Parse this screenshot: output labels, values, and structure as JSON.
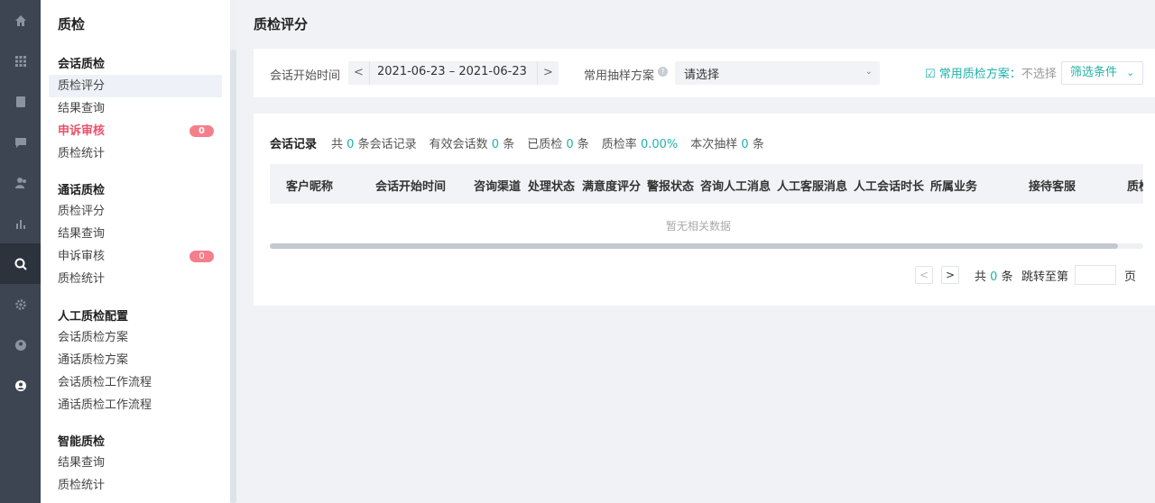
{
  "rail": {
    "items": [
      {
        "icon": "home-icon",
        "active": false
      },
      {
        "icon": "grid-icon",
        "active": false
      },
      {
        "icon": "document-icon",
        "active": false
      },
      {
        "icon": "chat-icon",
        "active": false
      },
      {
        "icon": "users-icon",
        "active": false
      },
      {
        "icon": "bar-chart-icon",
        "active": false
      },
      {
        "icon": "search-check-icon",
        "active": true
      },
      {
        "icon": "gear-icon",
        "active": false
      },
      {
        "icon": "user-circle-icon",
        "active": false
      },
      {
        "icon": "user-badge-icon",
        "active": false
      }
    ]
  },
  "sidebar": {
    "title": "质检",
    "groups": [
      {
        "title": "会话质检",
        "items": [
          {
            "label": "质检评分",
            "selected": true
          },
          {
            "label": "结果查询"
          },
          {
            "label": "申诉审核",
            "active": true,
            "badge": "0"
          },
          {
            "label": "质检统计"
          }
        ]
      },
      {
        "title": "通话质检",
        "items": [
          {
            "label": "质检评分"
          },
          {
            "label": "结果查询"
          },
          {
            "label": "申诉审核",
            "badge": "0"
          },
          {
            "label": "质检统计"
          }
        ]
      },
      {
        "title": "人工质检配置",
        "items": [
          {
            "label": "会话质检方案"
          },
          {
            "label": "通话质检方案"
          },
          {
            "label": "会话质检工作流程"
          },
          {
            "label": "通话质检工作流程"
          }
        ]
      },
      {
        "title": "智能质检",
        "items": [
          {
            "label": "结果查询"
          },
          {
            "label": "质检统计"
          }
        ]
      }
    ]
  },
  "page": {
    "title": "质检评分"
  },
  "filters": {
    "date_label": "会话开始时间",
    "date_prev": "<",
    "date_range": "2021-06-23 – 2021-06-23",
    "date_next": ">",
    "plan_label": "常用抽样方案",
    "plan_placeholder": "请选择",
    "common_plan_label": "常用质检方案：",
    "common_plan_value": "不选择",
    "filter_button": "筛选条件"
  },
  "stats": {
    "title": "会话记录",
    "total_prefix": "共",
    "total": "0",
    "total_suffix": "条会话记录",
    "valid_prefix": "有效会话数",
    "valid": "0",
    "valid_suffix": "条",
    "checked_prefix": "已质检",
    "checked": "0",
    "checked_suffix": "条",
    "rate_prefix": "质检率",
    "rate": "0.00%",
    "sample_prefix": "本次抽样",
    "sample": "0",
    "sample_suffix": "条"
  },
  "table": {
    "columns": [
      "客户昵称",
      "会话开始时间",
      "咨询渠道",
      "处理状态",
      "满意度评分",
      "警报状态",
      "咨询人工消息",
      "人工客服消息",
      "人工会话时长",
      "所属业务",
      "接待客服",
      "质检"
    ],
    "empty_text": "暂无相关数据"
  },
  "pager": {
    "prev": "<",
    "next": ">",
    "total_prefix": "共",
    "total": "0",
    "total_suffix": "条",
    "jump_label": "跳转至第",
    "page_suffix": "页"
  },
  "colors": {
    "accent": "#20b2aa",
    "alert": "#e8526b",
    "rail": "#3d4552"
  }
}
